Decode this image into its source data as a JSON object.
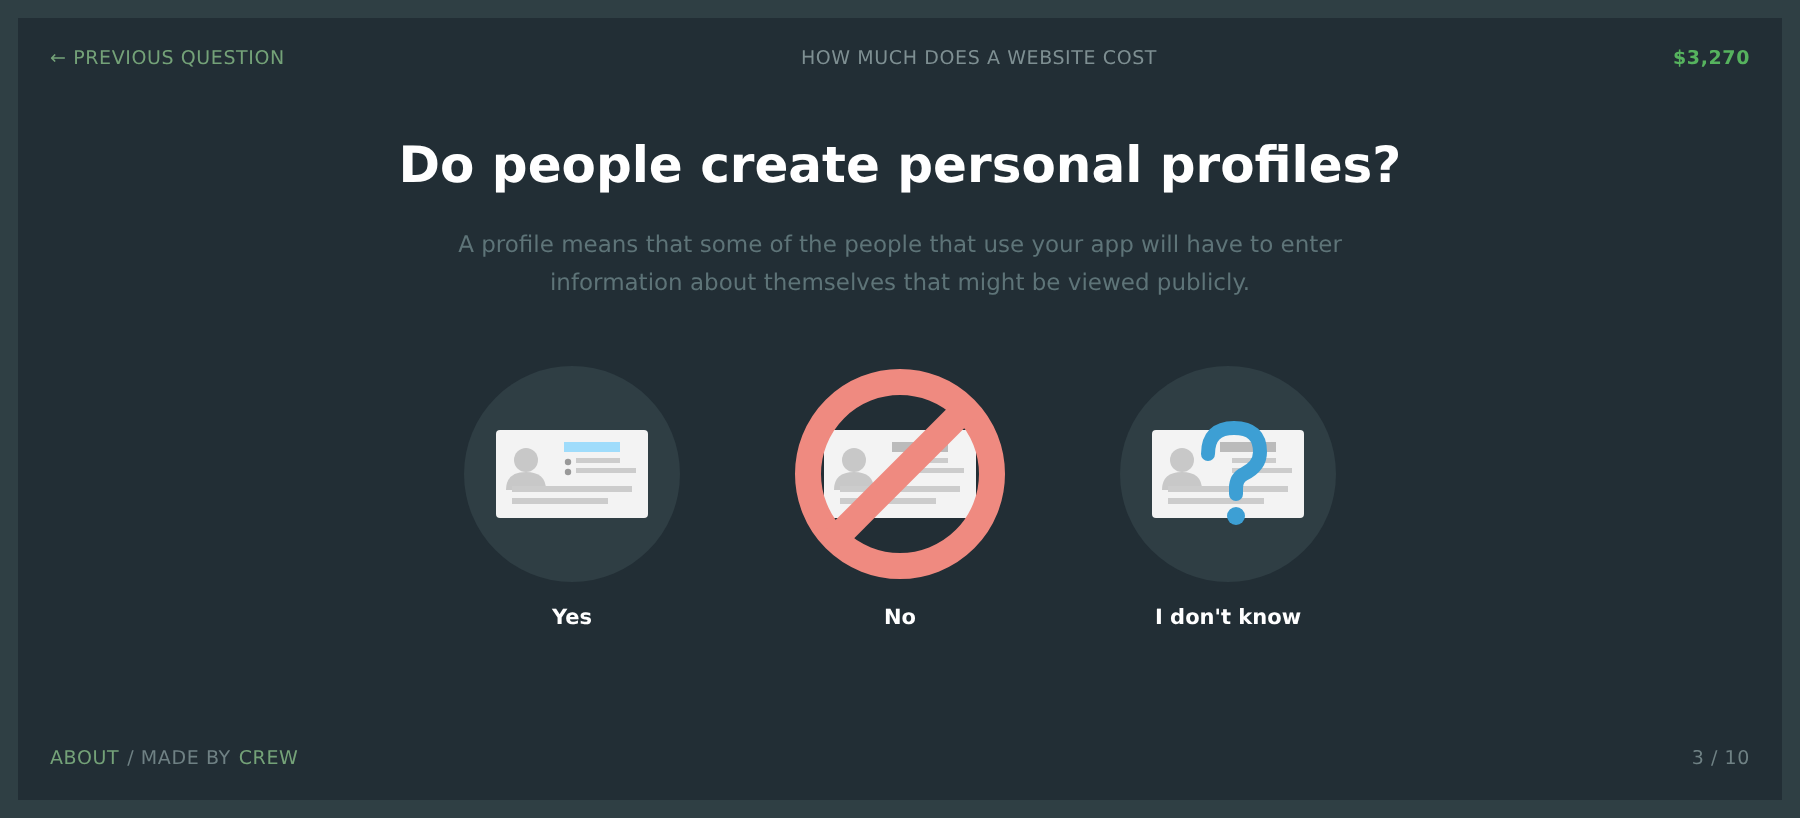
{
  "header": {
    "back_arrow": "←",
    "back_link": "PREVIOUS QUESTION",
    "site_title": "HOW MUCH DOES A WEBSITE COST",
    "total": "$3,270"
  },
  "question": {
    "title": "Do people create personal profiles?",
    "description": "A profile means that some of the people that use your app will have to enter information about themselves that might be viewed publicly."
  },
  "options": [
    {
      "kind": "yes",
      "label": "Yes"
    },
    {
      "kind": "no",
      "label": "No"
    },
    {
      "kind": "unknown",
      "label": "I don't know"
    }
  ],
  "footer": {
    "about_link": "ABOUT",
    "separator": "/ MADE BY",
    "crew_link": "CREW",
    "progress": "3 / 10"
  }
}
